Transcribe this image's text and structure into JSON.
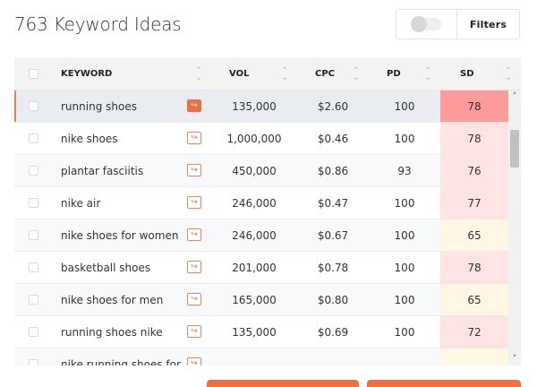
{
  "header": {
    "title": "763 Keyword Ideas",
    "filters_label": "Filters"
  },
  "table": {
    "columns": [
      "KEYWORD",
      "VOL",
      "CPC",
      "PD",
      "SD"
    ],
    "rows": [
      {
        "keyword": "running shoes",
        "vol": "135,000",
        "cpc": "$2.60",
        "pd": "100",
        "sd": "78",
        "sd_color": "#fd9b9b"
      },
      {
        "keyword": "nike shoes",
        "vol": "1,000,000",
        "cpc": "$0.46",
        "pd": "100",
        "sd": "78",
        "sd_color": "#fde3e3"
      },
      {
        "keyword": "plantar fasciitis",
        "vol": "450,000",
        "cpc": "$0.86",
        "pd": "93",
        "sd": "76",
        "sd_color": "#fde3e3"
      },
      {
        "keyword": "nike air",
        "vol": "246,000",
        "cpc": "$0.47",
        "pd": "100",
        "sd": "77",
        "sd_color": "#fde3e3"
      },
      {
        "keyword": "nike shoes for women",
        "vol": "246,000",
        "cpc": "$0.67",
        "pd": "100",
        "sd": "65",
        "sd_color": "#fff7e3"
      },
      {
        "keyword": "basketball shoes",
        "vol": "201,000",
        "cpc": "$0.78",
        "pd": "100",
        "sd": "78",
        "sd_color": "#fde3e3"
      },
      {
        "keyword": "nike shoes for men",
        "vol": "165,000",
        "cpc": "$0.80",
        "pd": "100",
        "sd": "65",
        "sd_color": "#fff7e3"
      },
      {
        "keyword": "running shoes nike",
        "vol": "135,000",
        "cpc": "$0.69",
        "pd": "100",
        "sd": "72",
        "sd_color": "#fde3e3"
      },
      {
        "keyword": "nike running shoes for",
        "vol": "",
        "cpc": "",
        "pd": "",
        "sd": "",
        "sd_color": "#fff7e3"
      }
    ]
  },
  "colors": {
    "accent": "#f06e3f",
    "selected_row": "#e9edf1"
  },
  "icons": {
    "go": "arrow-right-icon",
    "sort": "sort-icon",
    "scroll_up": "chevron-up-icon",
    "scroll_down": "chevron-down-icon"
  }
}
